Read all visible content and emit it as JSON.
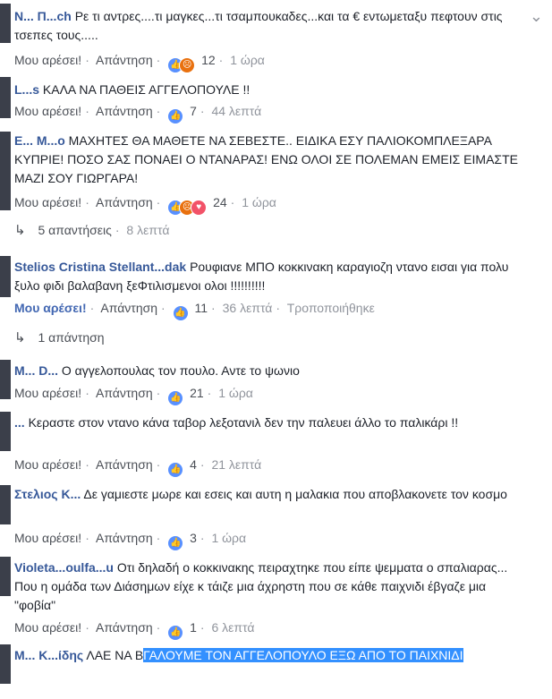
{
  "actions": {
    "like": "Μου αρέσει!",
    "reply": "Απάντηση",
    "edited": "Τροποποιήθηκε"
  },
  "comments": [
    {
      "name": "Ν... Π...ch",
      "text": "Ρε τι αντρες....τι μαγκες...τι τσαμπουκαδες...και τα € εντωμεταξυ πεφτουν στις τσεπες τους.....",
      "reactions": [
        "like",
        "angry"
      ],
      "count": "12",
      "time": "1 ώρα"
    },
    {
      "name": "L...s",
      "text": "ΚΑΛΑ ΝΑ ΠΑΘΕΙΣ ΑΓΓΕΛΟΠΟΥΛΕ !!",
      "reactions": [
        "like"
      ],
      "count": "7",
      "time": "44 λεπτά"
    },
    {
      "name": "Ε... Μ...ο",
      "text": "ΜΑΧΗΤΕΣ ΘΑ ΜΑΘΕΤΕ ΝΑ ΣΕΒΕΣΤΕ.. ΕΙΔΙΚΑ ΕΣΥ ΠΑΛΙΟΚΟΜΠΛΕΞΑΡΑ ΚΥΠΡΙΕ! ΠΟΣΟ ΣΑΣ ΠΟΝΑΕΙ Ο ΝΤΑΝΑΡΑΣ! ΕΝΩ ΟΛΟΙ ΣΕ ΠΟΛΕΜΑΝ ΕΜΕΙΣ ΕΙΜΑΣΤΕ ΜΑΖΙ ΣΟΥ ΓΙΩΡΓΑΡΑ!",
      "reactions": [
        "like",
        "angry",
        "love"
      ],
      "count": "24",
      "time": "1 ώρα"
    },
    {
      "name": "Stelios Cristina Stellant...dak",
      "text": "Ρουφιανε ΜΠΟ κοκκινακη καραγιοζη ντανο εισαι για πολυ ξυλο φιδι βαλαβανη ξεΦτιλισμενοι ολοι !!!!!!!!!!",
      "reactions": [
        "like"
      ],
      "count": "11",
      "time": "36 λεπτά",
      "edited": true
    },
    {
      "name": "M... D...",
      "text": "Ο αγγελοπουλας τον πουλο. Αντε το ψωνιο",
      "reactions": [
        "like"
      ],
      "count": "21",
      "time": "1 ώρα"
    },
    {
      "name": "...",
      "text": "Κεραστε στον ντανο κάνα ταβορ λεξοτανιλ δεν την παλευει άλλο το παλικάρι !!",
      "reactions": [
        "like"
      ],
      "count": "4",
      "time": "21 λεπτά"
    },
    {
      "name": "Στελιος Κ...",
      "text": "Δε γαμιεστε μωρε και εσεις και αυτη η μαλακια που αποβλακονετε τον κοσμο",
      "reactions": [
        "like"
      ],
      "count": "3",
      "time": "1 ώρα"
    },
    {
      "name": "Violeta...oulfa...u",
      "text": "Οτι δηλαδή ο κοκκινακης πειραχτηκε που είπε ψεμματα ο σπαλιαρας... Που η ομάδα των Διάσημων είχε κ τάιζε μια άχρηστη που σε κάθε παιχνιδι έβγαζε μια \"φοβία\"",
      "reactions": [
        "like"
      ],
      "count": "1",
      "time": "6 λεπτά"
    },
    {
      "name": "Μ... Κ...ίδης",
      "text_plain": "ΛΑΕ ΝΑ Β",
      "text_highlight": "ΓΑΛΟΥΜΕ ΤΟΝ ΑΓΓΕΛΟΠΟΥΛΟ ΕΞΩ ΑΠΟ ΤΟ ΠΑΙΧΝΙΔΙ"
    }
  ],
  "replies": [
    {
      "label": "5 απαντήσεις",
      "time": "8 λεπτά"
    },
    {
      "label": "1 απάντηση"
    }
  ],
  "icons": {
    "chevron": "chevron-down-icon",
    "reply_arrow": "reply-arrow-icon",
    "like": "like-reaction-icon",
    "angry": "angry-reaction-icon",
    "love": "love-reaction-icon"
  }
}
